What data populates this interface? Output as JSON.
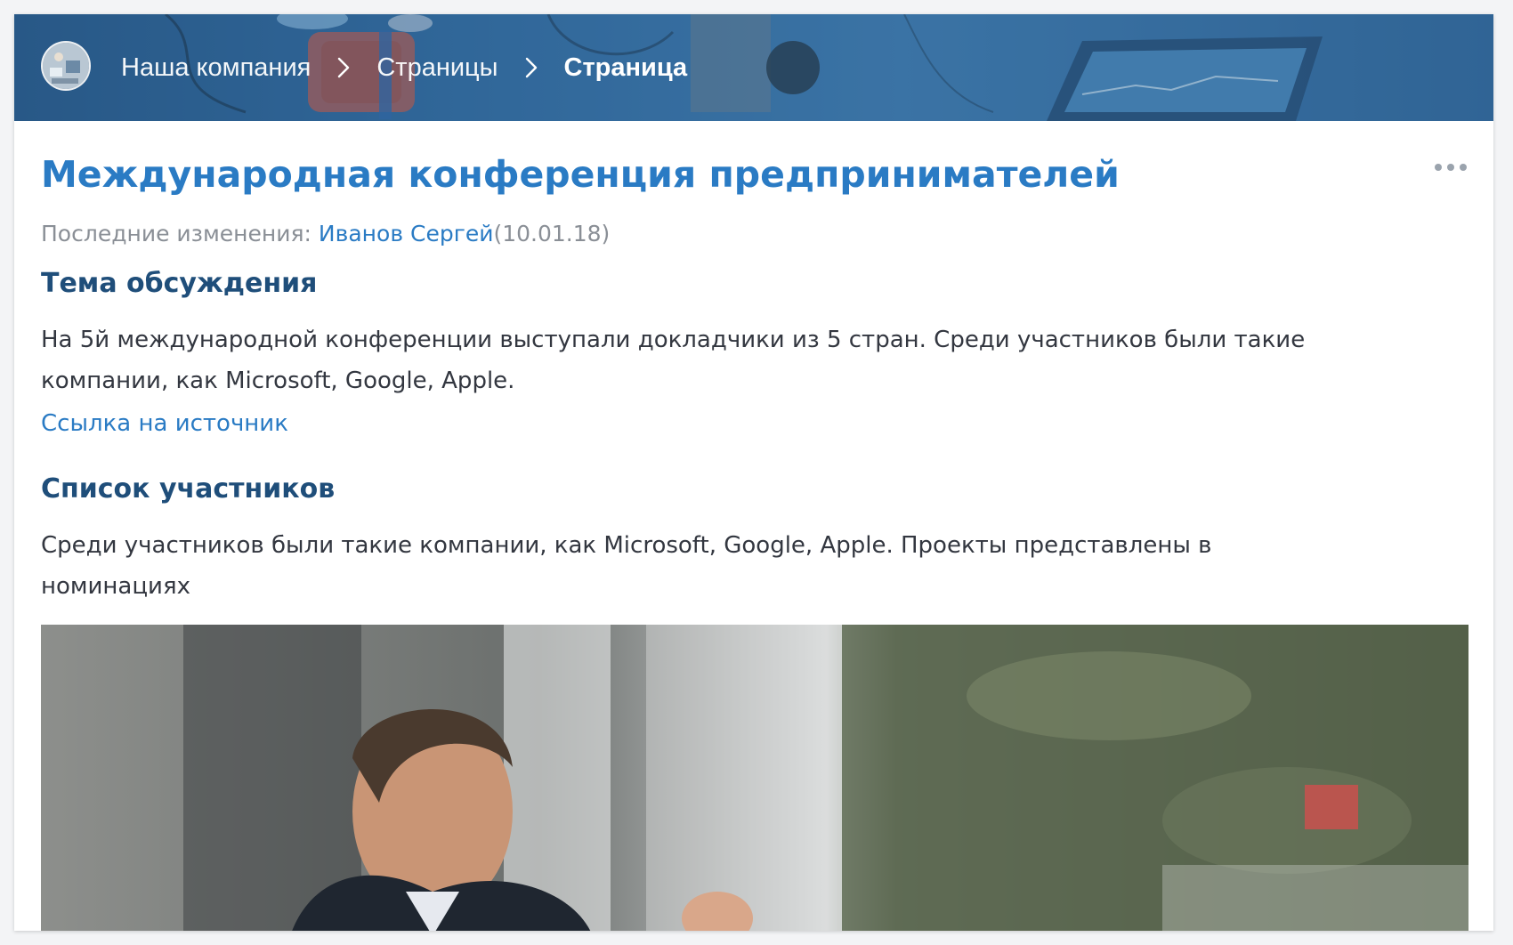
{
  "header": {
    "breadcrumbs": [
      {
        "label": "Наша компания"
      },
      {
        "label": "Страницы"
      },
      {
        "label": "Страница"
      }
    ],
    "icons": {
      "avatar": "company-avatar",
      "separator": "chevron-right-icon"
    }
  },
  "page": {
    "title": "Международная конференция предпринимателей",
    "meta": {
      "prefix": "Последние изменения:",
      "author": "Иванов Сергей",
      "date": "(10.01.18)"
    },
    "more_icon": "more-horizontal-icon"
  },
  "sections": [
    {
      "heading": "Тема обсуждения",
      "text": "На 5й международной конференции выступали докладчики из 5 стран. Среди участников были такие компании, как Microsoft, Google, Apple.",
      "link": "Ссылка на источник"
    },
    {
      "heading": "Список участников",
      "text": "Среди участников были такие компании, как Microsoft, Google, Apple. Проекты представлены в номинациях"
    }
  ],
  "colors": {
    "accent": "#2a7bc4",
    "heading": "#1f4e7a",
    "banner": "#3b73a6",
    "muted": "#8a8f96"
  }
}
